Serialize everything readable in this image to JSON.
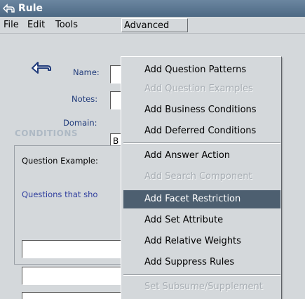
{
  "window": {
    "title": "Rule",
    "title_icon": "rule-arrow-icon"
  },
  "menubar": {
    "items": [
      "File",
      "Edit",
      "Tools",
      "Advanced"
    ]
  },
  "form": {
    "name_label": "Name:",
    "notes_label": "Notes:",
    "domain_label": "Domain:",
    "domain_value": "B"
  },
  "conditions": {
    "heading": "CONDITIONS",
    "tab_label": "Question Example:",
    "link_text": "Questions that sho"
  },
  "advanced_menu": {
    "items": [
      {
        "label": "Add Question Patterns",
        "enabled": true
      },
      {
        "label": "Add Question Examples",
        "enabled": false
      },
      {
        "label": "Add Business Conditions",
        "enabled": true
      },
      {
        "label": "Add Deferred Conditions",
        "enabled": true
      },
      {
        "label": "Add Answer Action",
        "enabled": true
      },
      {
        "label": "Add Search Component",
        "enabled": false
      },
      {
        "label": "Add Facet Restriction",
        "enabled": true,
        "highlighted": true
      },
      {
        "label": "Add Set Attribute",
        "enabled": true
      },
      {
        "label": "Add Relative Weights",
        "enabled": true
      },
      {
        "label": "Add Suppress Rules",
        "enabled": true
      },
      {
        "label": "Set Subsume/Supplement",
        "enabled": false
      }
    ]
  },
  "colors": {
    "titlebar": "#5a7691",
    "menu_highlight": "#4d5f70",
    "label_blue": "#1f3a7a"
  }
}
